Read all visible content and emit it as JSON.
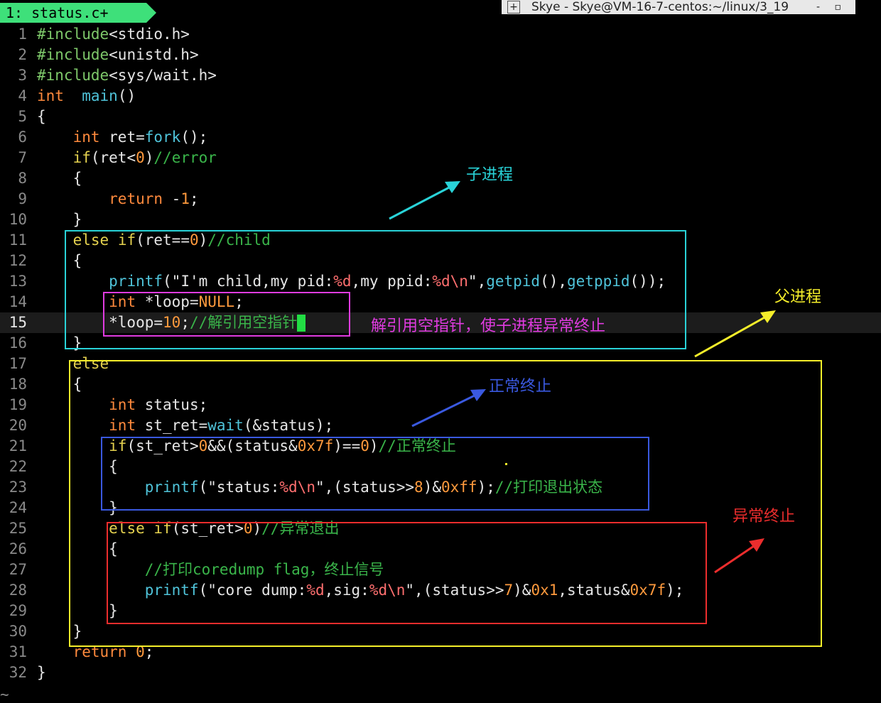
{
  "window": {
    "title": "Skye - Skye@VM-16-7-centos:~/linux/3_19",
    "controls": "- ▫"
  },
  "tab": {
    "label": "1: status.c+"
  },
  "code_lines": [
    {
      "n": "1",
      "spans": [
        [
          "pp",
          "#include"
        ],
        [
          "str",
          "<stdio.h>"
        ]
      ]
    },
    {
      "n": "2",
      "spans": [
        [
          "pp",
          "#include"
        ],
        [
          "str",
          "<unistd.h>"
        ]
      ]
    },
    {
      "n": "3",
      "spans": [
        [
          "pp",
          "#include"
        ],
        [
          "str",
          "<sys/wait.h>"
        ]
      ]
    },
    {
      "n": "4",
      "spans": [
        [
          "ty",
          "int"
        ],
        [
          "",
          "  "
        ],
        [
          "fn",
          "main"
        ],
        [
          "",
          "()"
        ]
      ]
    },
    {
      "n": "5",
      "spans": [
        [
          "",
          "{"
        ]
      ]
    },
    {
      "n": "6",
      "spans": [
        [
          "",
          "    "
        ],
        [
          "ty",
          "int"
        ],
        [
          "",
          " ret="
        ],
        [
          "fn",
          "fork"
        ],
        [
          "",
          "();"
        ]
      ]
    },
    {
      "n": "7",
      "spans": [
        [
          "",
          "    "
        ],
        [
          "kw",
          "if"
        ],
        [
          "",
          "(ret<"
        ],
        [
          "num",
          "0"
        ],
        [
          "",
          ")"
        ],
        [
          "cm",
          "//error"
        ]
      ]
    },
    {
      "n": "8",
      "spans": [
        [
          "",
          "    {"
        ]
      ]
    },
    {
      "n": "9",
      "spans": [
        [
          "",
          "        "
        ],
        [
          "ty",
          "return"
        ],
        [
          "",
          " -"
        ],
        [
          "num",
          "1"
        ],
        [
          "",
          ";"
        ]
      ]
    },
    {
      "n": "10",
      "spans": [
        [
          "",
          "    }"
        ]
      ]
    },
    {
      "n": "11",
      "spans": [
        [
          "",
          "    "
        ],
        [
          "kw",
          "else"
        ],
        [
          "",
          " "
        ],
        [
          "kw",
          "if"
        ],
        [
          "",
          "(ret=="
        ],
        [
          "num",
          "0"
        ],
        [
          "",
          ")"
        ],
        [
          "cm",
          "//child"
        ]
      ]
    },
    {
      "n": "12",
      "spans": [
        [
          "",
          "    {"
        ]
      ]
    },
    {
      "n": "13",
      "spans": [
        [
          "",
          "        "
        ],
        [
          "fn",
          "printf"
        ],
        [
          "",
          "(\""
        ],
        [
          "str",
          "I'm child,my pid:"
        ],
        [
          "esc",
          "%d"
        ],
        [
          "str",
          ",my ppid:"
        ],
        [
          "esc",
          "%d\\n"
        ],
        [
          "",
          "\","
        ],
        [
          "fn",
          "getpid"
        ],
        [
          "",
          "(),"
        ],
        [
          "fn",
          "getppid"
        ],
        [
          "",
          "());"
        ]
      ]
    },
    {
      "n": "14",
      "spans": [
        [
          "",
          "        "
        ],
        [
          "ty",
          "int"
        ],
        [
          "",
          " *loop="
        ],
        [
          "num",
          "NULL"
        ],
        [
          "",
          ";"
        ]
      ]
    },
    {
      "n": "15",
      "spans": [
        [
          "",
          "        *loop="
        ],
        [
          "num",
          "10"
        ],
        [
          "",
          ";"
        ],
        [
          "cm",
          "//解引用空指针"
        ]
      ]
    },
    {
      "n": "16",
      "spans": [
        [
          "",
          "    }"
        ]
      ]
    },
    {
      "n": "17",
      "spans": [
        [
          "",
          "    "
        ],
        [
          "kw",
          "else"
        ]
      ]
    },
    {
      "n": "18",
      "spans": [
        [
          "",
          "    {"
        ]
      ]
    },
    {
      "n": "19",
      "spans": [
        [
          "",
          "        "
        ],
        [
          "ty",
          "int"
        ],
        [
          "",
          " status;"
        ]
      ]
    },
    {
      "n": "20",
      "spans": [
        [
          "",
          "        "
        ],
        [
          "ty",
          "int"
        ],
        [
          "",
          " st_ret="
        ],
        [
          "fn",
          "wait"
        ],
        [
          "",
          "(&status);"
        ]
      ]
    },
    {
      "n": "21",
      "spans": [
        [
          "",
          "        "
        ],
        [
          "kw",
          "if"
        ],
        [
          "",
          "(st_ret>"
        ],
        [
          "num",
          "0"
        ],
        [
          "",
          "&&(status&"
        ],
        [
          "num",
          "0x7f"
        ],
        [
          "",
          ")=="
        ],
        [
          "num",
          "0"
        ],
        [
          "",
          ")"
        ],
        [
          "cm",
          "//正常终止"
        ]
      ]
    },
    {
      "n": "22",
      "spans": [
        [
          "",
          "        {"
        ]
      ]
    },
    {
      "n": "23",
      "spans": [
        [
          "",
          "            "
        ],
        [
          "fn",
          "printf"
        ],
        [
          "",
          "(\""
        ],
        [
          "str",
          "status:"
        ],
        [
          "esc",
          "%d\\n"
        ],
        [
          "",
          "\",(status>>"
        ],
        [
          "num",
          "8"
        ],
        [
          "",
          ")&"
        ],
        [
          "num",
          "0xff"
        ],
        [
          "",
          ");"
        ],
        [
          "cm",
          "//打印退出状态"
        ]
      ]
    },
    {
      "n": "24",
      "spans": [
        [
          "",
          "        }"
        ]
      ]
    },
    {
      "n": "25",
      "spans": [
        [
          "",
          "        "
        ],
        [
          "kw",
          "else"
        ],
        [
          "",
          " "
        ],
        [
          "kw",
          "if"
        ],
        [
          "",
          "(st_ret>"
        ],
        [
          "num",
          "0"
        ],
        [
          "",
          ")"
        ],
        [
          "cm",
          "//异常退出"
        ]
      ]
    },
    {
      "n": "26",
      "spans": [
        [
          "",
          "        {"
        ]
      ]
    },
    {
      "n": "27",
      "spans": [
        [
          "",
          "            "
        ],
        [
          "cm",
          "//打印coredump flag，终止信号"
        ]
      ]
    },
    {
      "n": "28",
      "spans": [
        [
          "",
          "            "
        ],
        [
          "fn",
          "printf"
        ],
        [
          "",
          "(\""
        ],
        [
          "str",
          "core dump:"
        ],
        [
          "esc",
          "%d"
        ],
        [
          "str",
          ",sig:"
        ],
        [
          "esc",
          "%d\\n"
        ],
        [
          "",
          "\",(status>>"
        ],
        [
          "num",
          "7"
        ],
        [
          "",
          ")&"
        ],
        [
          "num",
          "0x1"
        ],
        [
          "",
          ",status&"
        ],
        [
          "num",
          "0x7f"
        ],
        [
          "",
          ");"
        ]
      ]
    },
    {
      "n": "29",
      "spans": [
        [
          "",
          "        }"
        ]
      ]
    },
    {
      "n": "30",
      "spans": [
        [
          "",
          "    }"
        ]
      ]
    },
    {
      "n": "31",
      "spans": [
        [
          "",
          "    "
        ],
        [
          "ty",
          "return"
        ],
        [
          "",
          " "
        ],
        [
          "num",
          "0"
        ],
        [
          "",
          ";"
        ]
      ]
    },
    {
      "n": "32",
      "spans": [
        [
          "",
          "}"
        ]
      ]
    }
  ],
  "current_line": "15",
  "eob_marker": "~",
  "annotations": {
    "child_process": "子进程",
    "parent_process": "父进程",
    "null_deref": "解引用空指针，使子进程异常终止",
    "normal_exit": "正常终止",
    "abnormal_exit": "异常终止"
  },
  "colors": {
    "cyan": "#29d3d8",
    "yellow": "#f5ee2a",
    "magenta": "#e03be0",
    "blue": "#3a59e0",
    "red": "#ec2d2d",
    "tab_green": "#3ee07a"
  }
}
